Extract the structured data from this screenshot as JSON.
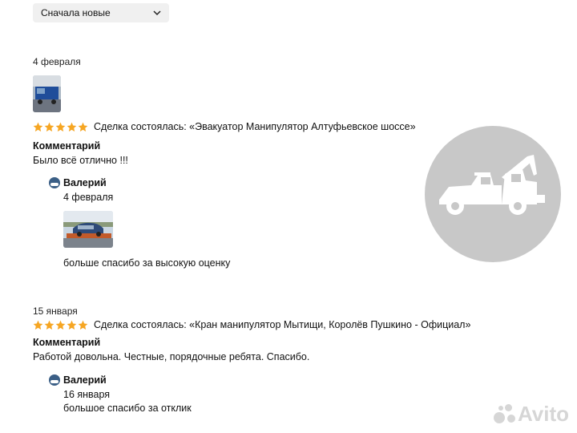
{
  "sort": {
    "selected": "Сначала новые"
  },
  "reviews": [
    {
      "date": "4 февраля",
      "rating": 5,
      "deal": "Сделка состоялась: «Эвакуатор Манипулятор Алтуфьевское шоссе»",
      "comment_label": "Комментарий",
      "comment": "Было всё отлично !!!",
      "reply": {
        "author": "Валерий",
        "date": "4 февраля",
        "text": "больше спасибо за высокую оценку"
      }
    },
    {
      "date": "15 января",
      "rating": 5,
      "deal": "Сделка состоялась: «Кран манипулятор Мытищи, Королёв Пушкино - Официал»",
      "comment_label": "Комментарий",
      "comment": "Работой довольна. Честные, порядочные ребята. Спасибо.",
      "reply": {
        "author": "Валерий",
        "date": "16 января",
        "text": "большое спасибо за отклик"
      }
    }
  ],
  "watermark": {
    "brand": "Avito"
  },
  "colors": {
    "star": "#f6a623",
    "watermark_circle": "#c8c8c8"
  }
}
